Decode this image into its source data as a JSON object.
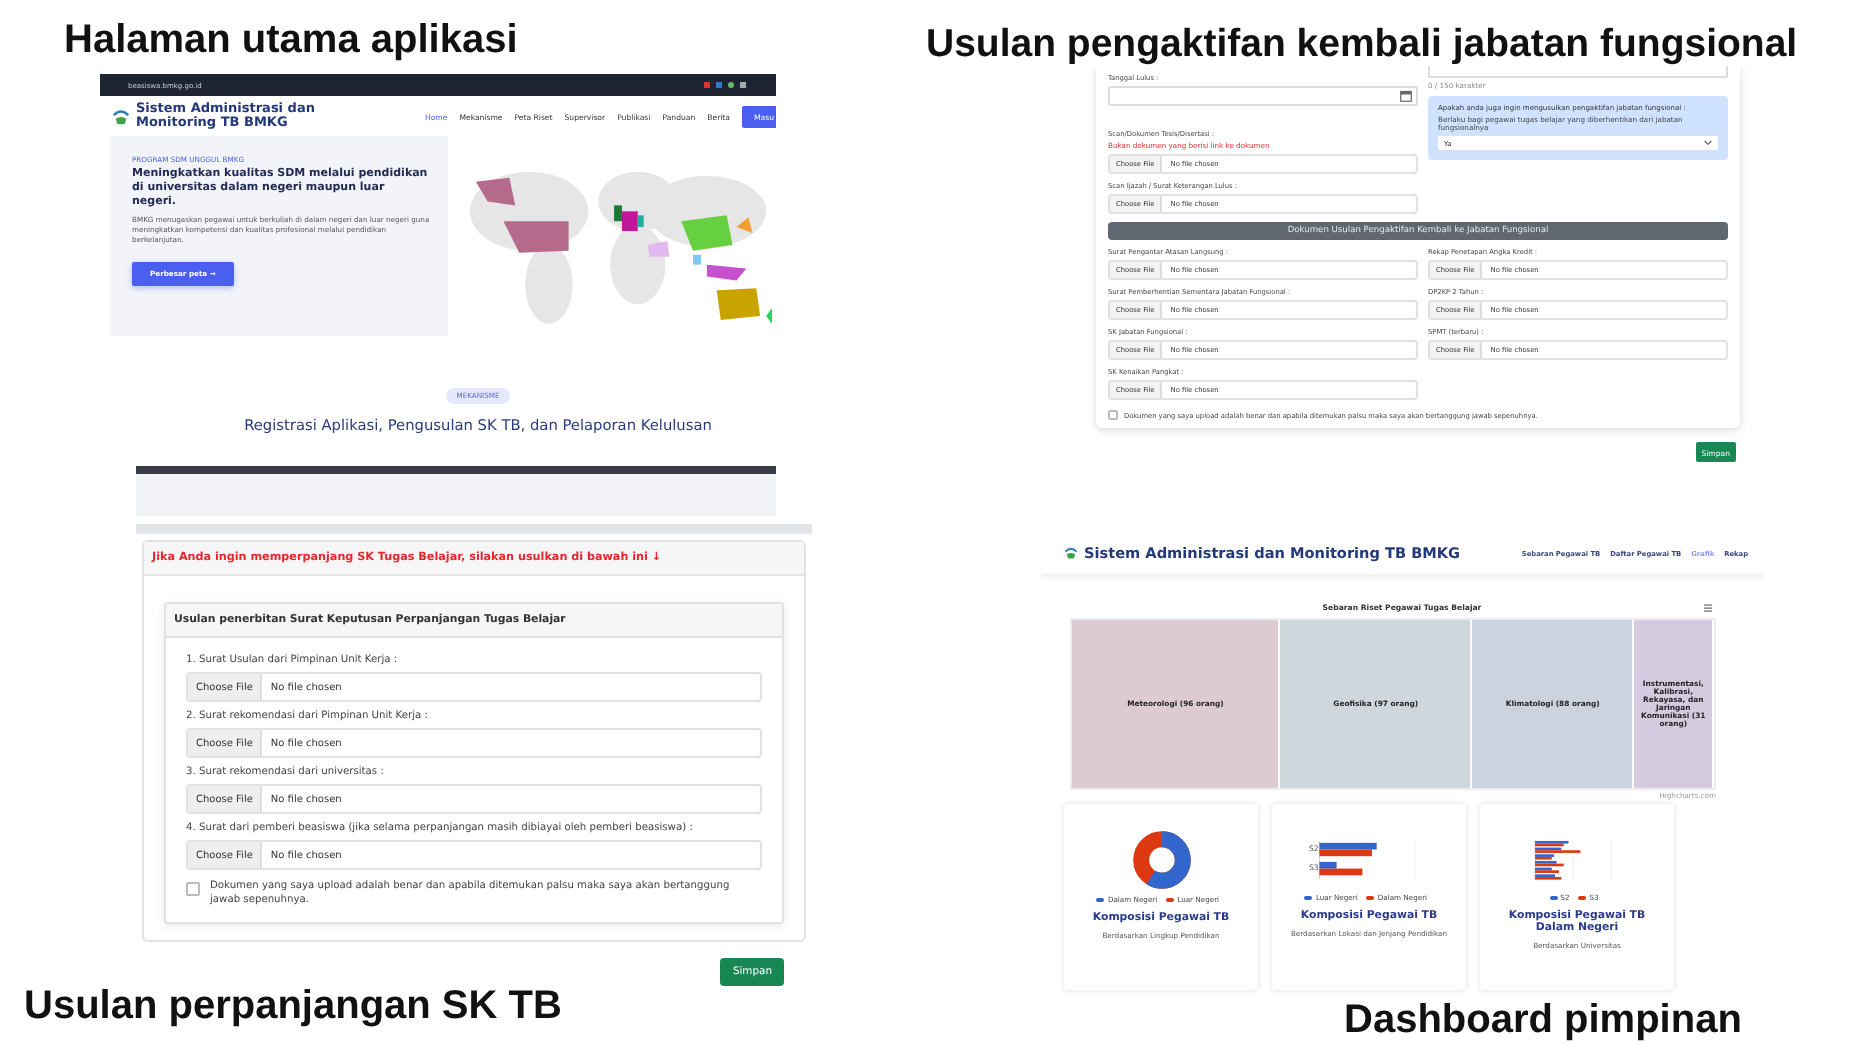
{
  "home": {
    "caption": "Halaman utama aplikasi",
    "url": "beasiswa.bmkg.go.id",
    "app_title": "Sistem Administrasi dan Monitoring TB BMKG",
    "nav": [
      {
        "label": "Home",
        "selected": true
      },
      {
        "label": "Mekanisme",
        "selected": false
      },
      {
        "label": "Peta Riset",
        "selected": false
      },
      {
        "label": "Supervisor",
        "selected": false
      },
      {
        "label": "Publikasi",
        "selected": false
      },
      {
        "label": "Panduan",
        "selected": false
      },
      {
        "label": "Berita",
        "selected": false
      }
    ],
    "login_button": "Masu",
    "hero": {
      "eyebrow": "PROGRAM SDM UNGGUL BMKG",
      "heading": "Meningkatkan kualitas SDM melalui pendidikan di universitas dalam negeri maupun luar negeri.",
      "text": "BMKG menugaskan pegawai untuk berkuliah di dalam negeri dan luar negeri guna meningkatkan kompetensi dan kualitas profesional melalui pendidikan berkelanjutan.",
      "button": "Perbesar peta →"
    },
    "section_badge": "MEKANISME",
    "section_heading": "Registrasi Aplikasi, Pengusulan SK TB, dan Pelaporan Kelulusan"
  },
  "extension_form": {
    "caption": "Usulan perpanjangan SK TB",
    "notice": "Jika Anda ingin memperpanjang SK Tugas Belajar, silakan usulkan di bawah ini ↓",
    "card_title": "Usulan penerbitan Surat Keputusan Perpanjangan Tugas Belajar",
    "fields": [
      {
        "label": "1. Surat Usulan dari Pimpinan Unit Kerja :",
        "button": "Choose File",
        "status": "No file chosen"
      },
      {
        "label": "2. Surat rekomendasi dari Pimpinan Unit Kerja :",
        "button": "Choose File",
        "status": "No file chosen"
      },
      {
        "label": "3. Surat rekomendasi dari universitas :",
        "button": "Choose File",
        "status": "No file chosen"
      },
      {
        "label": "4. Surat dari pemberi beasiswa (jika selama perpanjangan masih dibiayai oleh pemberi beasiswa) :",
        "button": "Choose File",
        "status": "No file chosen"
      }
    ],
    "declaration": {
      "text": "Dokumen yang saya upload adalah benar dan apabila ditemukan palsu maka saya akan bertanggung jawab sepenuhnya.",
      "checked": false
    },
    "submit": "Simpan"
  },
  "reactivation_form": {
    "caption": "Usulan pengaktifan kembali jabatan fungsional",
    "char_counter": "0 / 150 karakter",
    "graduation_date_label": "Tanggal Lulus :",
    "thesis": {
      "label": "Scan/Dokumen Tesis/Disertasi :",
      "hint": "Bukan dokumen yang berisi link ke dokumen",
      "button": "Choose File",
      "status": "No file chosen"
    },
    "diploma": {
      "label": "Scan Ijazah / Surat Keterangan Lulus :",
      "button": "Choose File",
      "status": "No file chosen"
    },
    "question": {
      "text": "Apakah anda juga ingin mengusulkan pengaktifan jabatan fungsional :",
      "note": "Berlaku bagi pegawai tugas belajar yang diberhentikan dari jabatan fungsionalnya",
      "value": "Ya"
    },
    "section_title": "Dokumen Usulan Pengaktifan Kembali ke Jabatan Fungsional",
    "left_fields": [
      {
        "label": "Surat Pengantar Atasan Langsung :",
        "button": "Choose File",
        "status": "No file chosen"
      },
      {
        "label": "Surat Pemberhentian Sementara Jabatan Fungsional :",
        "button": "Choose File",
        "status": "No file chosen"
      },
      {
        "label": "SK Jabatan Fungsional :",
        "button": "Choose File",
        "status": "No file chosen"
      },
      {
        "label": "SK Kenaikan Pangkat :",
        "button": "Choose File",
        "status": "No file chosen"
      }
    ],
    "right_fields": [
      {
        "label": "Rekap Penetapan Angka Kredit :",
        "button": "Choose File",
        "status": "No file chosen"
      },
      {
        "label": "DP2KP 2 Tahun :",
        "button": "Choose File",
        "status": "No file chosen"
      },
      {
        "label": "SPMT (terbaru) :",
        "button": "Choose File",
        "status": "No file chosen"
      }
    ],
    "declaration": {
      "text": "Dokumen yang saya upload adalah benar dan apabila ditemukan palsu maka saya akan bertanggung jawab sepenuhnya.",
      "checked": false
    },
    "submit": "Simpan"
  },
  "dashboard": {
    "caption": "Dashboard pimpinan",
    "app_title": "Sistem Administrasi dan Monitoring TB BMKG",
    "nav": [
      {
        "label": "Sebaran Pegawai TB",
        "selected": false
      },
      {
        "label": "Daftar Pegawai TB",
        "selected": false
      },
      {
        "label": "Grafik",
        "selected": true
      },
      {
        "label": "Rekap",
        "selected": false
      }
    ],
    "treemap": {
      "title": "Sebaran Riset Pegawai Tugas Belajar",
      "credit": "Highcharts.com",
      "cells": [
        {
          "label": "Meteorologi (96 orang)",
          "color": "#dccbd2"
        },
        {
          "label": "Geofisika (97 orang)",
          "color": "#cdd7dc"
        },
        {
          "label": "Klimatologi (88 orang)",
          "color": "#cbd3df"
        },
        {
          "label": "Instrumentasi, Kalibrasi, Rekayasa, dan Jaringan Komunikasi (31 orang)",
          "color": "#d4cbe0"
        }
      ]
    },
    "cards": [
      {
        "kind": "donut",
        "title": "Komposisi Pegawai TB",
        "subtitle": "Berdasarkan Lingkup Pendidikan",
        "legend": [
          {
            "label": "Dalam Negeri",
            "color": "#3366cc"
          },
          {
            "label": "Luar Negeri",
            "color": "#dc3912"
          }
        ]
      },
      {
        "kind": "bars",
        "title": "Komposisi Pegawai TB",
        "subtitle": "Berdasarkan Lokasi dan Jenjang Pendidikan",
        "categories": [
          "S2",
          "S3"
        ],
        "legend": [
          {
            "label": "Luar Negeri",
            "color": "#3366cc"
          },
          {
            "label": "Dalam Negeri",
            "color": "#dc3912"
          }
        ]
      },
      {
        "kind": "bars6",
        "title": "Komposisi Pegawai TB Dalam Negeri",
        "subtitle": "Berdasarkan Universitas",
        "legend": [
          {
            "label": "S2",
            "color": "#3366cc"
          },
          {
            "label": "S3",
            "color": "#dc3912"
          }
        ]
      }
    ]
  }
}
